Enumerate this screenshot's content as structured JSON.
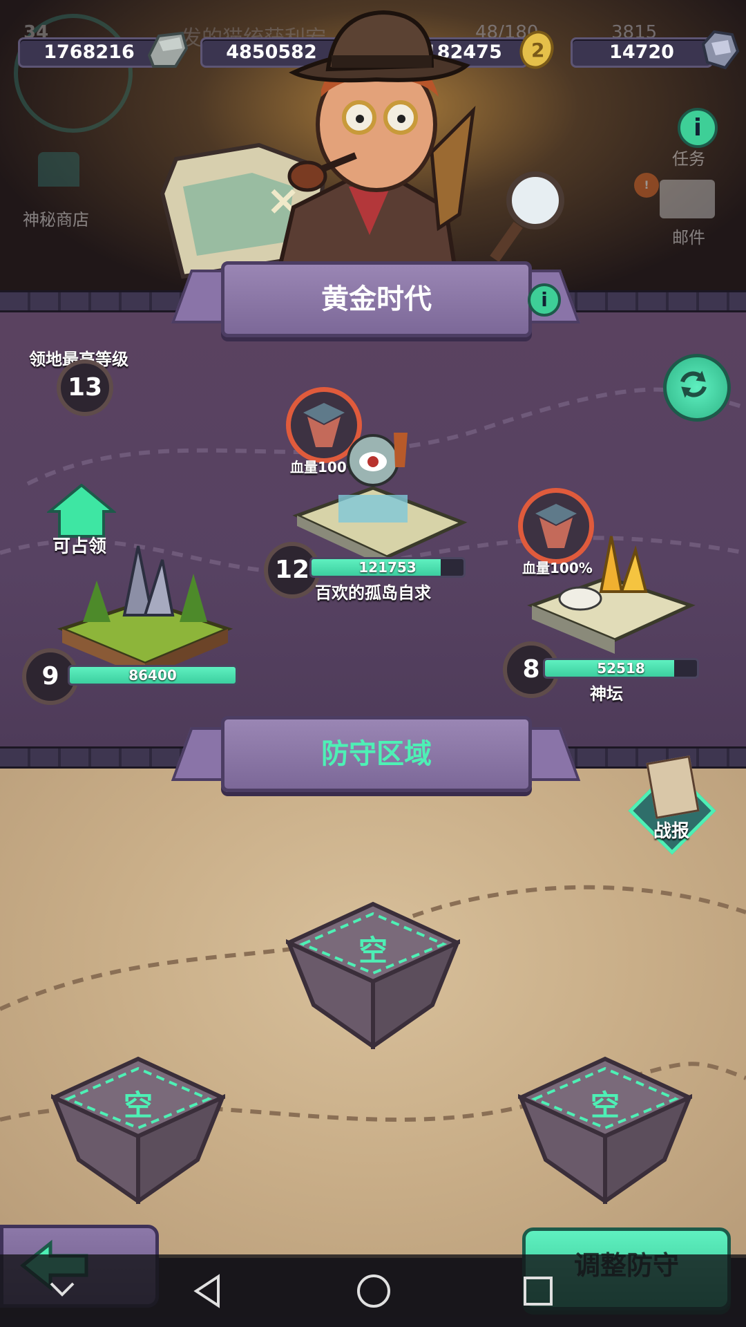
{
  "resources": [
    {
      "value": "1768216",
      "icon": "ore-stone-icon"
    },
    {
      "value": "4850582",
      "icon": "water-drop-icon"
    },
    {
      "value": "1182475",
      "icon": "gold-coin-icon"
    },
    {
      "value": "14720",
      "icon": "gem-crystal-icon"
    }
  ],
  "topbar_bg": {
    "left_counter": "34",
    "quota": "48/180",
    "right_num": "3815",
    "title_partial": "发的猫统获利宏"
  },
  "side_left": {
    "shop_label": "神秘商店"
  },
  "side_right": {
    "task_label": "任务",
    "mail_label": "邮件"
  },
  "era_banner": {
    "title": "黄金时代"
  },
  "territory": {
    "max_level_label": "领地最高等级",
    "max_level": "13",
    "nodes": [
      {
        "level": "9",
        "resource_value": "86400",
        "hp_fraction": 1.0,
        "status": "可占领",
        "name": ""
      },
      {
        "level": "12",
        "resource_value": "121753",
        "hp_fraction": 0.85,
        "hp_label": "血量100%",
        "name": "百欢的孤岛自求"
      },
      {
        "level": "8",
        "resource_value": "52518",
        "hp_fraction": 0.85,
        "hp_label": "血量100%",
        "name": "神坛"
      }
    ]
  },
  "defense_banner": {
    "title": "防守区域"
  },
  "battle_report": {
    "label": "战报"
  },
  "defense_slots": [
    {
      "label": "空"
    },
    {
      "label": "空"
    },
    {
      "label": "空"
    }
  ],
  "adjust_button": {
    "label": "调整防守"
  },
  "colors": {
    "accent_green": "#4ef0b5",
    "banner_purple": "#8a74a8",
    "alert_red": "#e05b3c"
  }
}
